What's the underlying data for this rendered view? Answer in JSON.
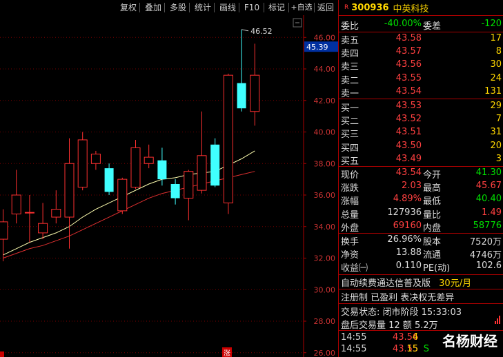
{
  "toolbar": {
    "items": [
      "复权",
      "叠加",
      "多股",
      "统计",
      "画线",
      "F10",
      "标记",
      "+自选",
      "返回"
    ]
  },
  "chart_data": {
    "type": "candlestick",
    "y_ticks": [
      "46.00",
      "44.00",
      "42.00",
      "40.00",
      "38.00",
      "36.00",
      "34.00",
      "32.00",
      "30.00",
      "28.00",
      "26.00"
    ],
    "ylim": [
      25.5,
      47.0
    ],
    "current_price_label": "45.39",
    "high_annotation": "46.52",
    "bottom_marker": "涨",
    "candles": [
      {
        "o": 33.2,
        "c": 34.3,
        "h": 35.1,
        "l": 31.8
      },
      {
        "o": 34.8,
        "c": 36.0,
        "h": 37.6,
        "l": 34.2
      },
      {
        "o": 34.9,
        "c": 34.9,
        "h": 36.0,
        "l": 33.0
      },
      {
        "o": 33.6,
        "c": 34.2,
        "h": 35.5,
        "l": 33.2
      },
      {
        "o": 34.6,
        "c": 35.1,
        "h": 36.3,
        "l": 34.2
      },
      {
        "o": 34.6,
        "c": 38.0,
        "h": 39.6,
        "l": 32.6
      },
      {
        "o": 36.5,
        "c": 39.5,
        "h": 40.0,
        "l": 36.3
      },
      {
        "o": 38.0,
        "c": 38.6,
        "h": 38.8,
        "l": 37.6
      },
      {
        "o": 37.7,
        "c": 36.2,
        "h": 38.0,
        "l": 36.0
      },
      {
        "o": 35.0,
        "c": 37.0,
        "h": 37.1,
        "l": 34.8
      },
      {
        "o": 36.5,
        "c": 39.0,
        "h": 39.5,
        "l": 36.4
      },
      {
        "o": 38.0,
        "c": 38.4,
        "h": 39.2,
        "l": 37.7
      },
      {
        "o": 38.2,
        "c": 37.0,
        "h": 39.0,
        "l": 36.6
      },
      {
        "o": 36.7,
        "c": 35.8,
        "h": 37.0,
        "l": 35.4
      },
      {
        "o": 35.8,
        "c": 37.5,
        "h": 37.6,
        "l": 34.4
      },
      {
        "o": 36.3,
        "c": 38.5,
        "h": 41.3,
        "l": 36.1
      },
      {
        "o": 39.2,
        "c": 36.6,
        "h": 39.6,
        "l": 36.5
      },
      {
        "o": 35.5,
        "c": 43.6,
        "h": 43.7,
        "l": 34.8
      },
      {
        "o": 43.1,
        "c": 41.5,
        "h": 46.5,
        "l": 41.3
      },
      {
        "o": 41.3,
        "c": 43.6,
        "h": 45.6,
        "l": 40.4
      }
    ],
    "ma_yellow": [
      32.2,
      32.6,
      33.0,
      33.3,
      33.6,
      34.0,
      34.6,
      35.1,
      35.5,
      35.9,
      36.3,
      36.7,
      37.0,
      37.1,
      37.3,
      37.4,
      37.5,
      37.9,
      38.3,
      38.8
    ],
    "ma_red": [
      32.0,
      32.3,
      32.6,
      32.8,
      33.1,
      33.4,
      33.8,
      34.2,
      34.6,
      35.0,
      35.4,
      35.8,
      36.1,
      36.3,
      36.5,
      36.7,
      36.9,
      37.1,
      37.3,
      37.5
    ]
  },
  "stock": {
    "badge": "R",
    "code": "300936",
    "name": "中英科技"
  },
  "weibi": {
    "label": "委比",
    "value": "-40.00%",
    "label2": "委差",
    "value2": "-120"
  },
  "sells": [
    {
      "label": "卖五",
      "price": "43.58",
      "vol": "17"
    },
    {
      "label": "卖四",
      "price": "43.57",
      "vol": "8"
    },
    {
      "label": "卖三",
      "price": "43.56",
      "vol": "30"
    },
    {
      "label": "卖二",
      "price": "43.55",
      "vol": "24"
    },
    {
      "label": "卖一",
      "price": "43.54",
      "vol": "131"
    }
  ],
  "buys": [
    {
      "label": "买一",
      "price": "43.53",
      "vol": "29"
    },
    {
      "label": "买二",
      "price": "43.52",
      "vol": "7"
    },
    {
      "label": "买三",
      "price": "43.51",
      "vol": "31"
    },
    {
      "label": "买四",
      "price": "43.50",
      "vol": "20"
    },
    {
      "label": "买五",
      "price": "43.49",
      "vol": "3"
    }
  ],
  "quote": [
    {
      "l1": "现价",
      "v1": "43.54",
      "c1": "red",
      "l2": "今开",
      "v2": "41.30",
      "c2": "green"
    },
    {
      "l1": "涨跌",
      "v1": "2.03",
      "c1": "red",
      "l2": "最高",
      "v2": "45.67",
      "c2": "red"
    },
    {
      "l1": "涨幅",
      "v1": "4.89%",
      "c1": "red",
      "l2": "最低",
      "v2": "40.40",
      "c2": "green"
    },
    {
      "l1": "总量",
      "v1": "127936",
      "c1": "white",
      "l2": "量比",
      "v2": "1.49",
      "c2": "red"
    },
    {
      "l1": "外盘",
      "v1": "69160",
      "c1": "red",
      "l2": "内盘",
      "v2": "58776",
      "c2": "green"
    }
  ],
  "fundamentals": [
    {
      "l1": "换手",
      "v1": "26.96%",
      "l2": "股本",
      "v2": "7520万"
    },
    {
      "l1": "净资",
      "v1": "13.88",
      "l2": "流通",
      "v2": "4746万"
    },
    {
      "l1": "收益㈠",
      "v1": "0.110",
      "l2": "PE(动)",
      "v2": "102.6"
    }
  ],
  "promo": {
    "text": "自动续费通达信普及版",
    "price": "30元/月"
  },
  "register": "注册制 已盈利 表决权无差异",
  "trade_status": "交易状态: 闭市阶段 15:33:03",
  "after_hours": "盘后交易量 12 额 5.2万",
  "ticks": [
    {
      "time": "14:55",
      "price": "43.56",
      "vol": "4",
      "flag": ""
    },
    {
      "time": "14:55",
      "price": "43.55",
      "vol": "15",
      "flag": "S"
    }
  ],
  "watermark": "名杨财经"
}
